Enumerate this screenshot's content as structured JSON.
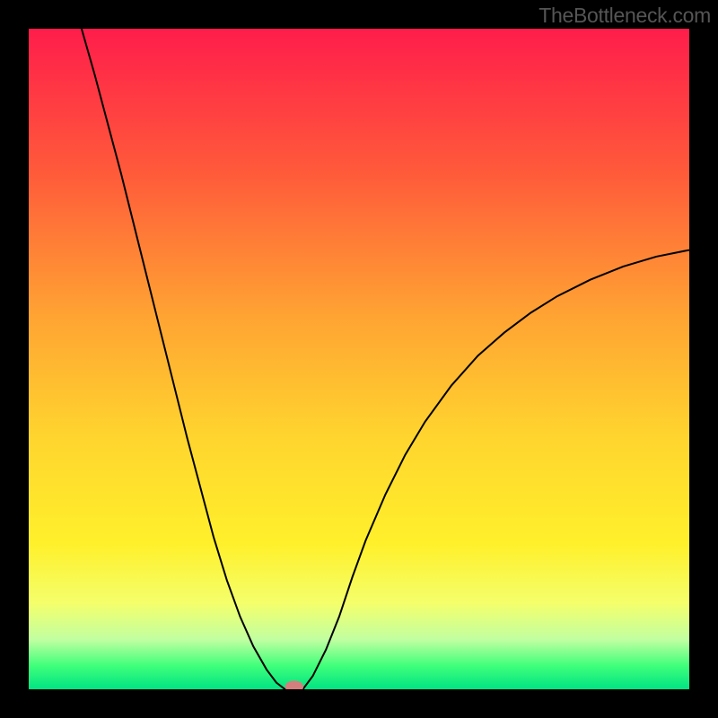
{
  "watermark": "TheBottleneck.com",
  "chart_data": {
    "type": "line",
    "title": "",
    "xlabel": "",
    "ylabel": "",
    "xlim": [
      0,
      100
    ],
    "ylim": [
      0,
      100
    ],
    "background_gradient": {
      "colors": [
        "#ff1d4b",
        "#ff5b3a",
        "#ffa233",
        "#ffd52e",
        "#fff02b",
        "#f4ff6b",
        "#c1ffa1",
        "#3eff7a",
        "#00e383"
      ],
      "positions": [
        0.0,
        0.22,
        0.43,
        0.62,
        0.78,
        0.87,
        0.925,
        0.965,
        1.0
      ]
    },
    "series": [
      {
        "name": "left-limb",
        "stroke": "#000000",
        "x": [
          8.0,
          10.0,
          12.0,
          14.0,
          16.0,
          18.0,
          20.0,
          22.0,
          24.0,
          26.0,
          28.0,
          30.0,
          32.0,
          34.0,
          36.0,
          37.5,
          38.8
        ],
        "y": [
          100.0,
          93.0,
          85.5,
          78.0,
          70.0,
          62.0,
          54.0,
          46.0,
          38.0,
          30.5,
          23.0,
          16.5,
          11.0,
          6.5,
          3.0,
          1.0,
          0.0
        ]
      },
      {
        "name": "valley-floor",
        "stroke": "#000000",
        "x": [
          38.8,
          41.5
        ],
        "y": [
          0.0,
          0.0
        ]
      },
      {
        "name": "right-limb",
        "stroke": "#000000",
        "x": [
          41.5,
          43.0,
          45.0,
          47.0,
          49.0,
          51.0,
          54.0,
          57.0,
          60.0,
          64.0,
          68.0,
          72.0,
          76.0,
          80.0,
          85.0,
          90.0,
          95.0,
          100.0
        ],
        "y": [
          0.0,
          2.0,
          6.0,
          11.0,
          17.0,
          22.5,
          29.5,
          35.5,
          40.5,
          46.0,
          50.5,
          54.0,
          57.0,
          59.5,
          62.0,
          64.0,
          65.5,
          66.5
        ]
      }
    ],
    "marker": {
      "name": "valley-marker",
      "x": 40.2,
      "y": 0.4,
      "color": "#d47e7e",
      "rx": 1.4,
      "ry": 0.9
    }
  }
}
